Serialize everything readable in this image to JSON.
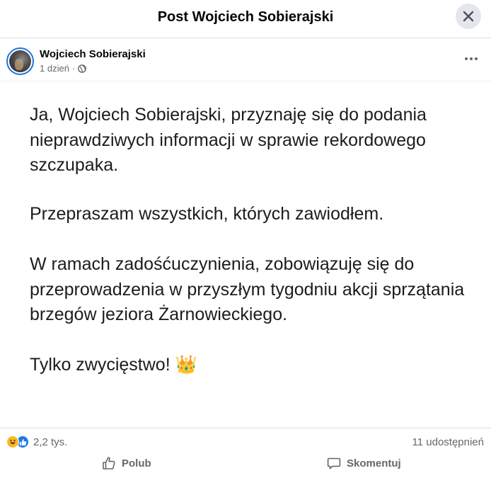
{
  "header": {
    "title": "Post Wojciech Sobierajski",
    "close_icon": "close-icon"
  },
  "author": {
    "name": "Wojciech Sobierajski",
    "time": "1 dzień",
    "separator": "·",
    "audience_icon": "globe-icon",
    "more_icon": "more-horizontal-icon"
  },
  "post": {
    "paragraphs": [
      "Ja, Wojciech Sobierajski, przyznaję się do podania nieprawdziwych informacji w sprawie rekordowego szczupaka.",
      "Przepraszam wszystkich, których zawiodłem.",
      "W ramach zadośćuczynienia, zobowiązuję się do przeprowadzenia w przyszłym tygodniu akcji sprzątania brzegów jeziora Żarnowieckiego.",
      "Tylko zwycięstwo! 👑"
    ]
  },
  "stats": {
    "reactions": [
      "haha-icon",
      "like-icon"
    ],
    "reaction_count": "2,2 tys.",
    "shares": "11 udostępnień"
  },
  "actions": {
    "like_label": "Polub",
    "comment_label": "Skomentuj"
  },
  "colors": {
    "accent": "#1877f2",
    "haha": "#f7b928",
    "secondary_text": "#65676b",
    "divider": "#dddfe2"
  }
}
